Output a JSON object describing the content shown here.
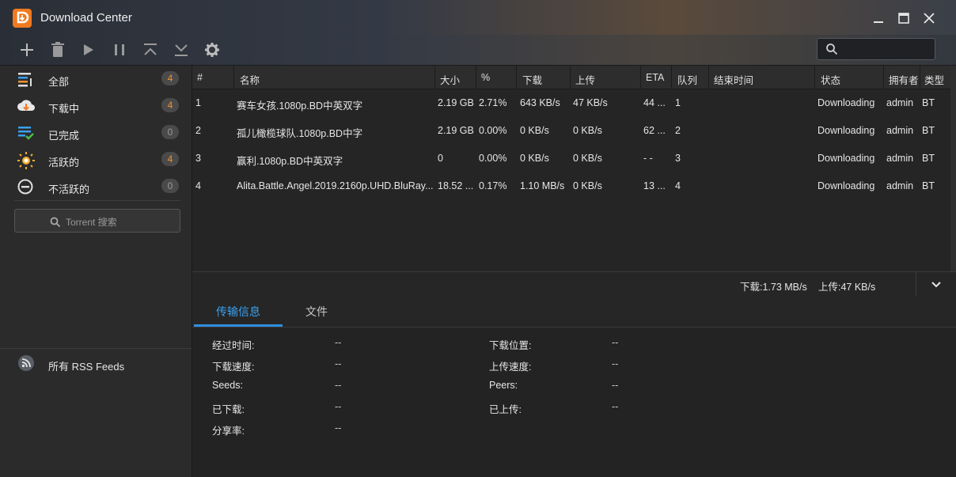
{
  "window": {
    "title": "Download Center"
  },
  "sidebar": {
    "items": [
      {
        "label": "全部",
        "count": "4",
        "icon": "list-all-icon"
      },
      {
        "label": "下载中",
        "count": "4",
        "icon": "cloud-download-icon"
      },
      {
        "label": "已完成",
        "count": "0",
        "icon": "list-check-icon"
      },
      {
        "label": "活跃的",
        "count": "4",
        "icon": "sun-active-icon"
      },
      {
        "label": "不活跃的",
        "count": "0",
        "icon": "minus-circle-icon"
      }
    ],
    "torrent_search_placeholder": "Torrent 搜索",
    "rss_label": "所有 RSS Feeds"
  },
  "table": {
    "headers": [
      "#",
      "名称",
      "大小",
      "%",
      "下载",
      "上传",
      "ETA",
      "队列",
      "结束时间",
      "状态",
      "拥有者",
      "类型"
    ],
    "rows": [
      {
        "num": "1",
        "name": "赛车女孩.1080p.BD中英双字",
        "size": "2.19 GB",
        "pct": "2.71%",
        "down": "643 KB/s",
        "up": "47 KB/s",
        "eta": "44 ...",
        "queue": "1",
        "end": "",
        "status": "Downloading",
        "owner": "admin",
        "type": "BT"
      },
      {
        "num": "2",
        "name": "孤儿橄榄球队.1080p.BD中字",
        "size": "2.19 GB",
        "pct": "0.00%",
        "down": "0 KB/s",
        "up": "0 KB/s",
        "eta": "62 ...",
        "queue": "2",
        "end": "",
        "status": "Downloading",
        "owner": "admin",
        "type": "BT"
      },
      {
        "num": "3",
        "name": "赢利.1080p.BD中英双字",
        "size": "0",
        "pct": "0.00%",
        "down": "0 KB/s",
        "up": "0 KB/s",
        "eta": "- -",
        "queue": "3",
        "end": "",
        "status": "Downloading",
        "owner": "admin",
        "type": "BT"
      },
      {
        "num": "4",
        "name": "Alita.Battle.Angel.2019.2160p.UHD.BluRay...",
        "size": "18.52 ...",
        "pct": "0.17%",
        "down": "1.10 MB/s",
        "up": "0 KB/s",
        "eta": "13 ...",
        "queue": "4",
        "end": "",
        "status": "Downloading",
        "owner": "admin",
        "type": "BT"
      }
    ]
  },
  "status": {
    "download": "下载:1.73 MB/s",
    "upload": "上传:47 KB/s"
  },
  "detail_tabs": [
    "传输信息",
    "文件"
  ],
  "details": {
    "left": [
      {
        "key": "经过时间:",
        "value": "--"
      },
      {
        "key": "下载速度:",
        "value": "--"
      },
      {
        "key": "Seeds:",
        "value": "--"
      },
      {
        "key": "已下载:",
        "value": "--"
      },
      {
        "key": "分享率:",
        "value": "--"
      }
    ],
    "right": [
      {
        "key": "下载位置:",
        "value": "--"
      },
      {
        "key": "上传速度:",
        "value": "--"
      },
      {
        "key": "Peers:",
        "value": "--"
      },
      {
        "key": "已上传:",
        "value": "--"
      }
    ]
  },
  "colors": {
    "accent": "#2f8ee0",
    "logo": "#f07a20",
    "badge_orange": "#f0922e"
  }
}
